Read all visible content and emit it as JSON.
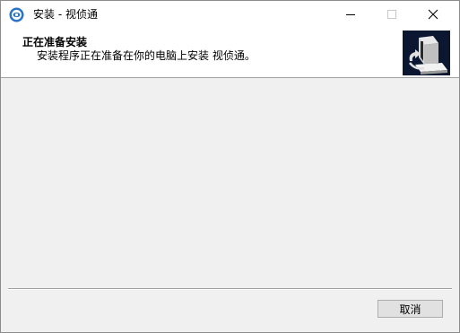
{
  "window": {
    "title": "安装 - 视侦通",
    "controls": {
      "minimize_icon": "minimize-icon",
      "maximize_icon": "maximize-icon",
      "close_icon": "close-icon"
    }
  },
  "header": {
    "title": "正在准备安装",
    "subtitle": "安装程序正在准备在你的电脑上安装 视侦通。"
  },
  "footer": {
    "cancel_label": "取消"
  },
  "colors": {
    "content_background": "#f0f0f0",
    "header_background": "#ffffff",
    "logo_background": "#0b1730"
  }
}
